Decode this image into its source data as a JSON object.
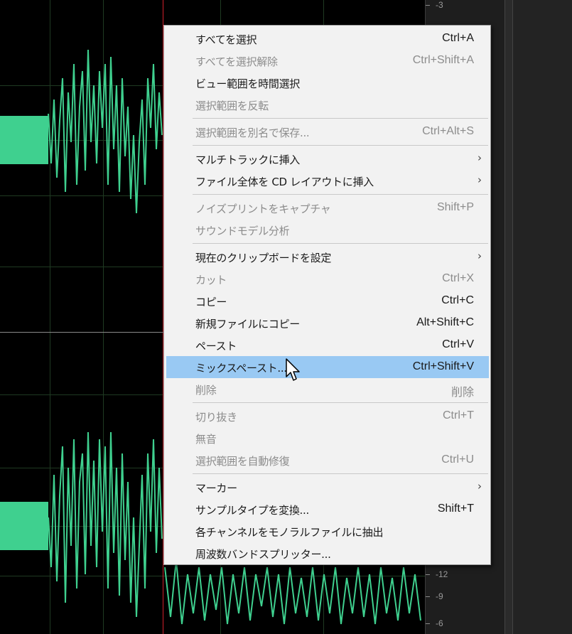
{
  "ruler": {
    "labels": [
      "-3",
      "-12",
      "-9",
      "-6"
    ]
  },
  "menu": {
    "items": [
      {
        "label": "すべてを選択",
        "shortcut": "Ctrl+A",
        "disabled": false
      },
      {
        "label": "すべてを選択解除",
        "shortcut": "Ctrl+Shift+A",
        "disabled": true
      },
      {
        "label": "ビュー範囲を時間選択",
        "shortcut": "",
        "disabled": false
      },
      {
        "label": "選択範囲を反転",
        "shortcut": "",
        "disabled": true
      },
      {
        "label": "選択範囲を別名で保存...",
        "shortcut": "Ctrl+Alt+S",
        "disabled": true
      },
      {
        "label": "マルチトラックに挿入",
        "shortcut": "",
        "disabled": false,
        "submenu": true
      },
      {
        "label": "ファイル全体を CD レイアウトに挿入",
        "shortcut": "",
        "disabled": false,
        "submenu": true
      },
      {
        "label": "ノイズプリントをキャプチャ",
        "shortcut": "Shift+P",
        "disabled": true
      },
      {
        "label": "サウンドモデル分析",
        "shortcut": "",
        "disabled": true
      },
      {
        "label": "現在のクリップボードを設定",
        "shortcut": "",
        "disabled": false,
        "submenu": true
      },
      {
        "label": "カット",
        "shortcut": "Ctrl+X",
        "disabled": true
      },
      {
        "label": "コピー",
        "shortcut": "Ctrl+C",
        "disabled": false
      },
      {
        "label": "新規ファイルにコピー",
        "shortcut": "Alt+Shift+C",
        "disabled": false
      },
      {
        "label": "ペースト",
        "shortcut": "Ctrl+V",
        "disabled": false
      },
      {
        "label": "ミックスペースト...",
        "shortcut": "Ctrl+Shift+V",
        "disabled": false,
        "highlighted": true
      },
      {
        "label": "削除",
        "shortcut": "削除",
        "disabled": true
      },
      {
        "label": "切り抜き",
        "shortcut": "Ctrl+T",
        "disabled": true
      },
      {
        "label": "無音",
        "shortcut": "",
        "disabled": true
      },
      {
        "label": "選択範囲を自動修復",
        "shortcut": "Ctrl+U",
        "disabled": true
      },
      {
        "label": "マーカー",
        "shortcut": "",
        "disabled": false,
        "submenu": true
      },
      {
        "label": "サンプルタイプを変換...",
        "shortcut": "Shift+T",
        "disabled": false
      },
      {
        "label": "各チャンネルをモノラルファイルに抽出",
        "shortcut": "",
        "disabled": false
      },
      {
        "label": "周波数バンドスプリッター...",
        "shortcut": "",
        "disabled": false
      }
    ],
    "submenu_arrow": "›"
  },
  "colors": {
    "waveform": "#3fd08f",
    "playhead": "#d0202a",
    "menu_highlight": "#99c9f3"
  }
}
